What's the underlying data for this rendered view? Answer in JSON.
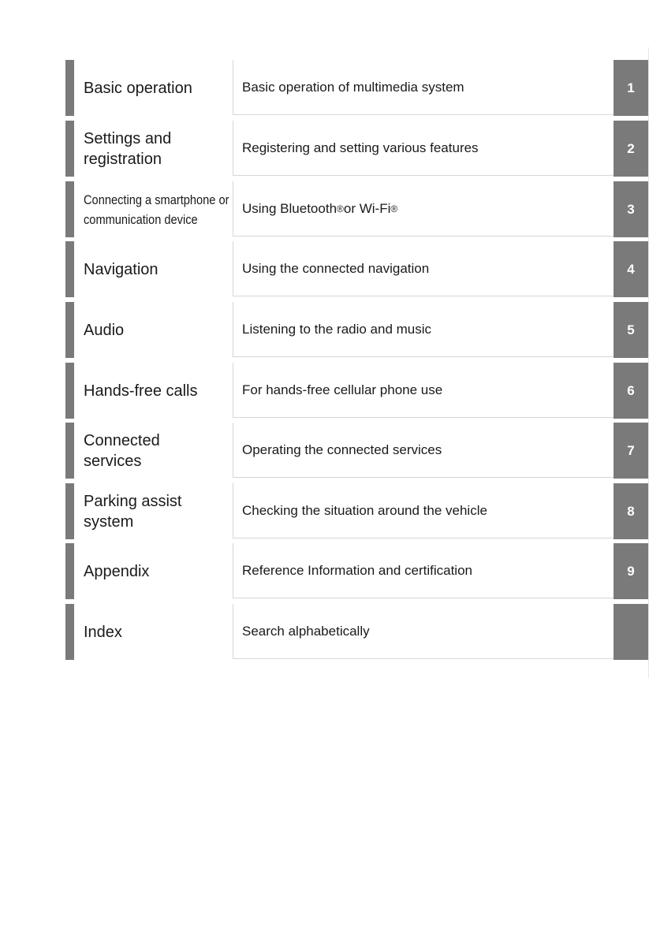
{
  "toc": [
    {
      "title": "Basic operation",
      "description": "Basic operation of multimedia system",
      "number": "1"
    },
    {
      "title": "Settings and registration",
      "description": "Registering and setting various features",
      "number": "2"
    },
    {
      "title": "Connecting a smartphone or communication device",
      "description_parts": [
        "Using Bluetooth",
        "®",
        " or Wi-Fi",
        "®"
      ],
      "number": "3"
    },
    {
      "title": "Navigation",
      "description": "Using the connected navigation",
      "number": "4"
    },
    {
      "title": "Audio",
      "description": "Listening to the radio and music",
      "number": "5"
    },
    {
      "title": "Hands-free calls",
      "description": "For hands-free cellular phone use",
      "number": "6"
    },
    {
      "title": "Connected services",
      "description": "Operating the connected services",
      "number": "7"
    },
    {
      "title": "Parking assist system",
      "description": "Checking the situation around the vehicle",
      "number": "8"
    },
    {
      "title": "Appendix",
      "description": "Reference Information and certification",
      "number": "9"
    },
    {
      "title": "Index",
      "description": "Search alphabetically",
      "number": ""
    }
  ],
  "colors": {
    "tab": "#7a7a7a",
    "divider": "#d6d6d6"
  }
}
